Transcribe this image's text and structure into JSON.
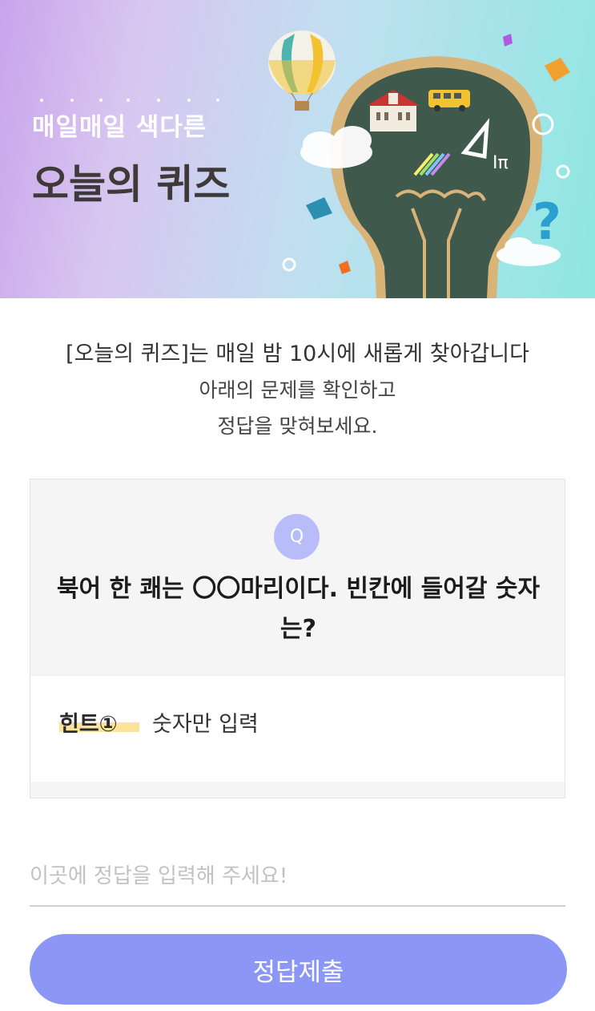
{
  "banner": {
    "subtitle": "매일매일 색다른",
    "title": "오늘의 퀴즈"
  },
  "intro": {
    "line1": "[오늘의 퀴즈]는 매일 밤 10시에 새롭게 찾아갑니다",
    "line2": "아래의 문제를 확인하고",
    "line3": "정답을 맞혀보세요."
  },
  "question": {
    "badge": "Q",
    "text": "북어 한 쾌는 〇〇마리이다. 빈칸에 들어갈 숫자는?"
  },
  "hint": {
    "label": "힌트①",
    "text": "숫자만 입력"
  },
  "answer": {
    "placeholder": "이곳에 정답을 입력해 주세요!",
    "value": ""
  },
  "submit": {
    "label": "정답제출"
  },
  "colors": {
    "accent": "#8c96f5",
    "badge": "#b8bdf9",
    "hint_highlight": "#fbe39a"
  }
}
